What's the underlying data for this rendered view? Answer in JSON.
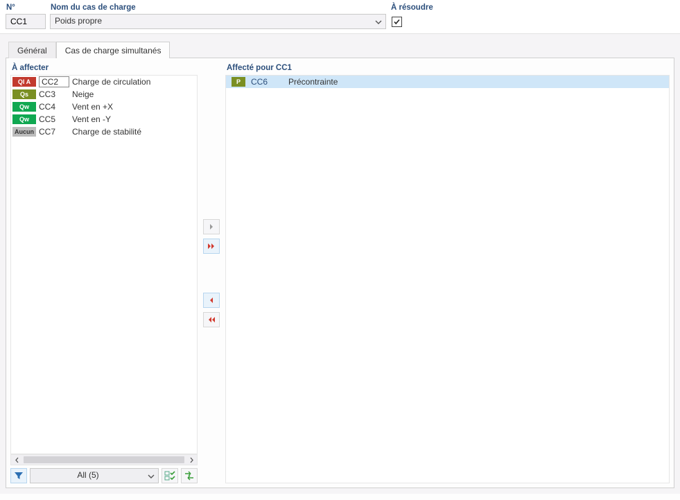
{
  "header": {
    "num_label": "N°",
    "num_value": "CC1",
    "name_label": "Nom du cas de charge",
    "name_value": "Poids propre",
    "solve_label": "À résoudre",
    "solve_checked": true
  },
  "tabs": {
    "general": "Général",
    "simultaneous": "Cas de charge simultanés",
    "active": "simultaneous"
  },
  "left": {
    "title": "À affecter",
    "items": [
      {
        "tag": "QI A",
        "tag_color": "#c23a2e",
        "code": "CC2",
        "desc": "Charge de circulation"
      },
      {
        "tag": "Qs",
        "tag_color": "#7a8f23",
        "code": "CC3",
        "desc": "Neige"
      },
      {
        "tag": "Qw",
        "tag_color": "#10a851",
        "code": "CC4",
        "desc": "Vent en +X"
      },
      {
        "tag": "Qw",
        "tag_color": "#10a851",
        "code": "CC5",
        "desc": "Vent en -Y"
      },
      {
        "tag": "Aucun",
        "tag_color": "#bcbcbc",
        "code": "CC7",
        "desc": "Charge de stabilité"
      }
    ],
    "filter_dropdown": "All (5)"
  },
  "right": {
    "title": "Affecté pour CC1",
    "items": [
      {
        "tag": "P",
        "tag_color": "#7a8f23",
        "code": "CC6",
        "desc": "Précontrainte"
      }
    ]
  },
  "icons": {
    "funnel": "funnel-icon",
    "check_list": "check-list-icon",
    "swap": "swap-icon"
  }
}
